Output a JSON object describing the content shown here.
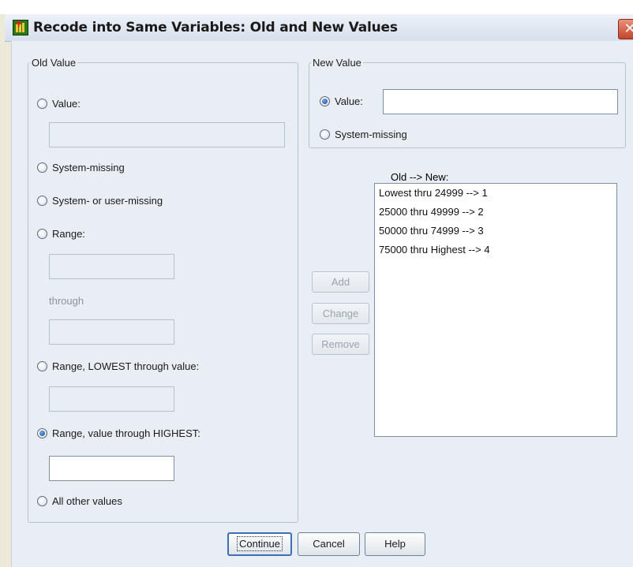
{
  "window": {
    "title": "Recode into Same Variables: Old and New Values",
    "close_glyph": "✕"
  },
  "old_value": {
    "legend": "Old Value",
    "value_label": "Value:",
    "value_input": "",
    "system_missing_label": "System-missing",
    "sys_user_missing_label": "System- or user-missing",
    "range_label": "Range:",
    "range_from": "",
    "through_label": "through",
    "range_to": "",
    "range_lowest_label": "Range, LOWEST through value:",
    "range_lowest_input": "",
    "range_highest_label": "Range, value through HIGHEST:",
    "range_highest_input": "",
    "all_other_label": "All other values",
    "selected": "range_highest"
  },
  "new_value": {
    "legend": "New Value",
    "value_label": "Value:",
    "value_input": "",
    "system_missing_label": "System-missing",
    "selected": "value"
  },
  "mapping": {
    "header": "Old --> New:",
    "items": [
      "Lowest thru 24999 --> 1",
      "25000 thru 49999 --> 2",
      "50000 thru 74999 --> 3",
      "75000 thru Highest --> 4"
    ]
  },
  "actions": {
    "add": "Add",
    "change": "Change",
    "remove": "Remove"
  },
  "footer": {
    "continue": "Continue",
    "cancel": "Cancel",
    "help": "Help"
  }
}
